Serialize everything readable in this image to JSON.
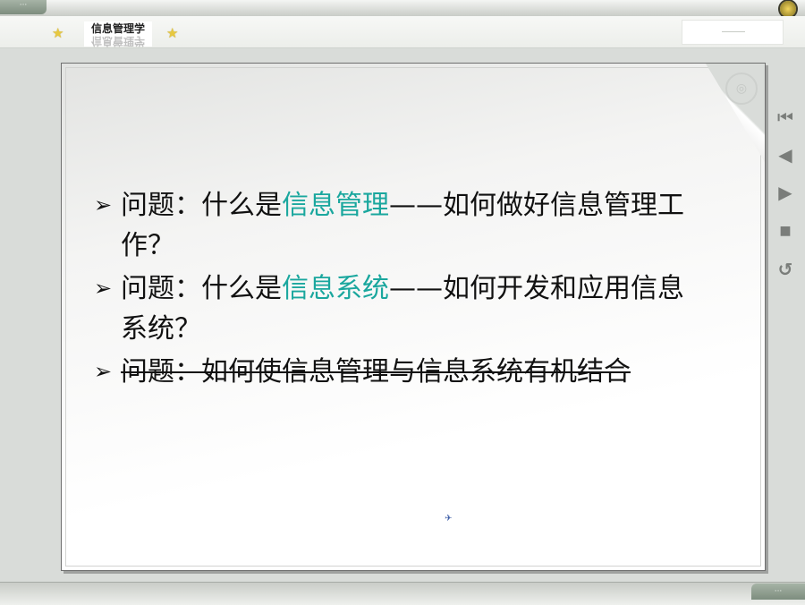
{
  "header": {
    "course_title": "信息管理学",
    "star_glyph": "★"
  },
  "bullets": [
    {
      "arrow": "➢",
      "prefix": "问题：什么是",
      "highlight": "信息管理",
      "suffix": "——如何做好信息管理工作？",
      "strikethrough": false
    },
    {
      "arrow": "➢",
      "prefix": "问题：什么是",
      "highlight": "信息系统",
      "suffix": "——如何开发和应用信息系统？",
      "strikethrough": false
    },
    {
      "arrow": "➢",
      "prefix": "问题：如何使信息管理与信息系统有机结合",
      "highlight": "",
      "suffix": "",
      "strikethrough": true
    }
  ],
  "nav": [
    {
      "name": "first-slide-icon",
      "glyph": "⏮"
    },
    {
      "name": "previous-slide-icon",
      "glyph": "◀"
    },
    {
      "name": "next-slide-icon",
      "glyph": "▶"
    },
    {
      "name": "video-icon",
      "glyph": "■"
    },
    {
      "name": "return-icon",
      "glyph": "↺"
    }
  ],
  "colors": {
    "highlight": "#1aa79e",
    "text": "#111111",
    "frame": "#d9dcd9"
  }
}
